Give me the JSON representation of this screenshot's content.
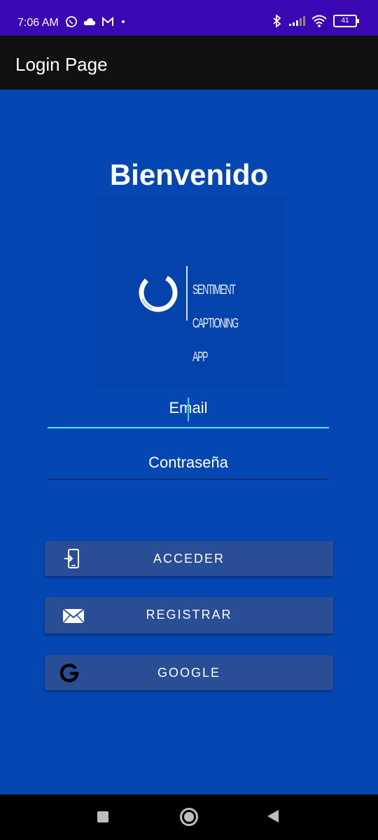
{
  "status_bar": {
    "time": "7:06 AM",
    "left_icons": [
      "whatsapp-icon",
      "cloud-icon",
      "gmail-icon",
      "dot-icon"
    ],
    "right_icons": [
      "bluetooth-icon",
      "signal-icon",
      "wifi-icon"
    ],
    "battery": "41"
  },
  "app_bar": {
    "title": "Login Page"
  },
  "main": {
    "welcome": "Bienvenido",
    "logo": {
      "line1": "SENTIMENT",
      "line2": "CAPTIONING",
      "line3": "APP"
    },
    "email_placeholder": "Email",
    "password_placeholder": "Contraseña",
    "accent_color": "#56e6ef"
  },
  "buttons": {
    "acceder": "ACCEDER",
    "registrar": "REGISTRAR",
    "google": "GOOGLE"
  },
  "colors": {
    "background": "#0446b2",
    "status_bar": "#3a08b2",
    "app_bar": "#111111",
    "button": "#2a4e96"
  }
}
